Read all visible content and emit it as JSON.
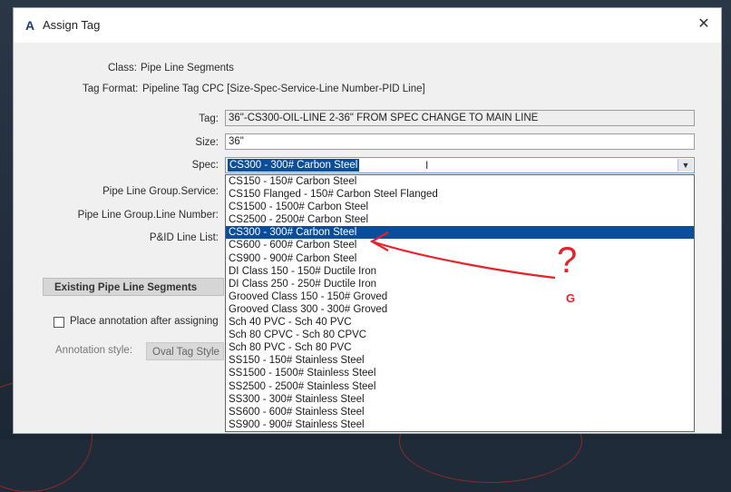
{
  "dialog": {
    "title": "Assign Tag",
    "app_icon": "A",
    "close_glyph": "✕"
  },
  "info": {
    "class_label": "Class:",
    "class_value": "Pipe Line Segments",
    "tag_format_label": "Tag Format:",
    "tag_format_value": "Pipeline Tag CPC [Size-Spec-Service-Line Number-PID Line]"
  },
  "fields": {
    "tag_label": "Tag:",
    "tag_value": "36\"-CS300-OIL-LINE 2-36\" FROM SPEC CHANGE TO MAIN LINE",
    "size_label": "Size:",
    "size_value": "36\"",
    "spec_label": "Spec:",
    "spec_value": "CS300 - 300# Carbon Steel",
    "service_label": "Pipe Line Group.Service:",
    "line_number_label": "Pipe Line Group.Line Number:",
    "pid_line_label": "P&ID Line List:"
  },
  "spec_options": [
    "CS150 - 150# Carbon Steel",
    "CS150 Flanged - 150# Carbon Steel Flanged",
    "CS1500 - 1500# Carbon Steel",
    "CS2500 - 2500# Carbon Steel",
    "CS300 - 300# Carbon Steel",
    "CS600 - 600# Carbon Steel",
    "CS900 - 900# Carbon Steel",
    "DI Class 150 - 150# Ductile Iron",
    "DI Class 250 - 250# Ductile Iron",
    "Grooved Class 150 - 150# Groved",
    "Grooved Class 300 - 300# Groved",
    "Sch 40 PVC - Sch 40 PVC",
    "Sch 80 CPVC - Sch 80 CPVC",
    "Sch 80 PVC - Sch 80 PVC",
    "SS150 - 150# Stainless Steel",
    "SS1500 - 1500# Stainless Steel",
    "SS2500 - 2500# Stainless Steel",
    "SS300 - 300# Stainless Steel",
    "SS600 - 600# Stainless Steel",
    "SS900 - 900# Stainless Steel"
  ],
  "spec_selected_index": 4,
  "existing": {
    "section_label": "Existing Pipe Line Segments",
    "place_annotation_label": "Place annotation after assigning",
    "annotation_style_label": "Annotation style:",
    "annotation_style_value": "Oval Tag Style"
  },
  "markup": {
    "question_mark": "?",
    "letter": "G",
    "color": "#e8202a"
  }
}
